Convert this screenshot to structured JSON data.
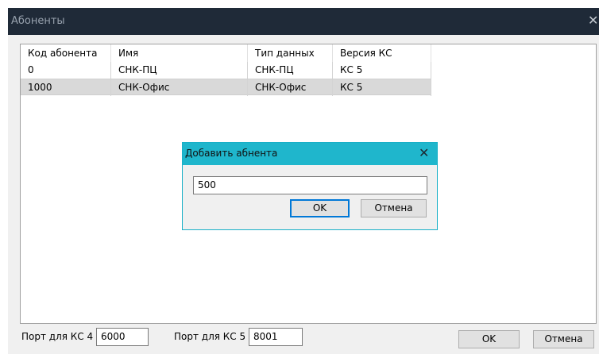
{
  "window": {
    "title": "Абоненты",
    "close_glyph": "✕"
  },
  "table": {
    "columns": [
      "Код абонента",
      "Имя",
      "Тип данных",
      "Версия КС"
    ],
    "rows": [
      [
        "0",
        "СНК-ПЦ",
        "СНК-ПЦ",
        "КС 5"
      ],
      [
        "1000",
        "СНК-Офис",
        "СНК-Офис",
        "КС 5"
      ]
    ],
    "selected_row_index": 1
  },
  "footer": {
    "port_kc4_label": "Порт для КС 4",
    "port_kc4_value": "6000",
    "port_kc5_label": "Порт для КС 5",
    "port_kc5_value": "8001",
    "ok_label": "OK",
    "cancel_label": "Отмена"
  },
  "dialog": {
    "title": "Добавить абнента",
    "close_glyph": "✕",
    "input_value": "500",
    "ok_label": "OK",
    "cancel_label": "Отмена"
  },
  "colors": {
    "main_titlebar": "#1f2a38",
    "dialog_titlebar": "#1fb6cc",
    "selected_row": "#d9d9d9",
    "default_button_border": "#0078d7"
  }
}
